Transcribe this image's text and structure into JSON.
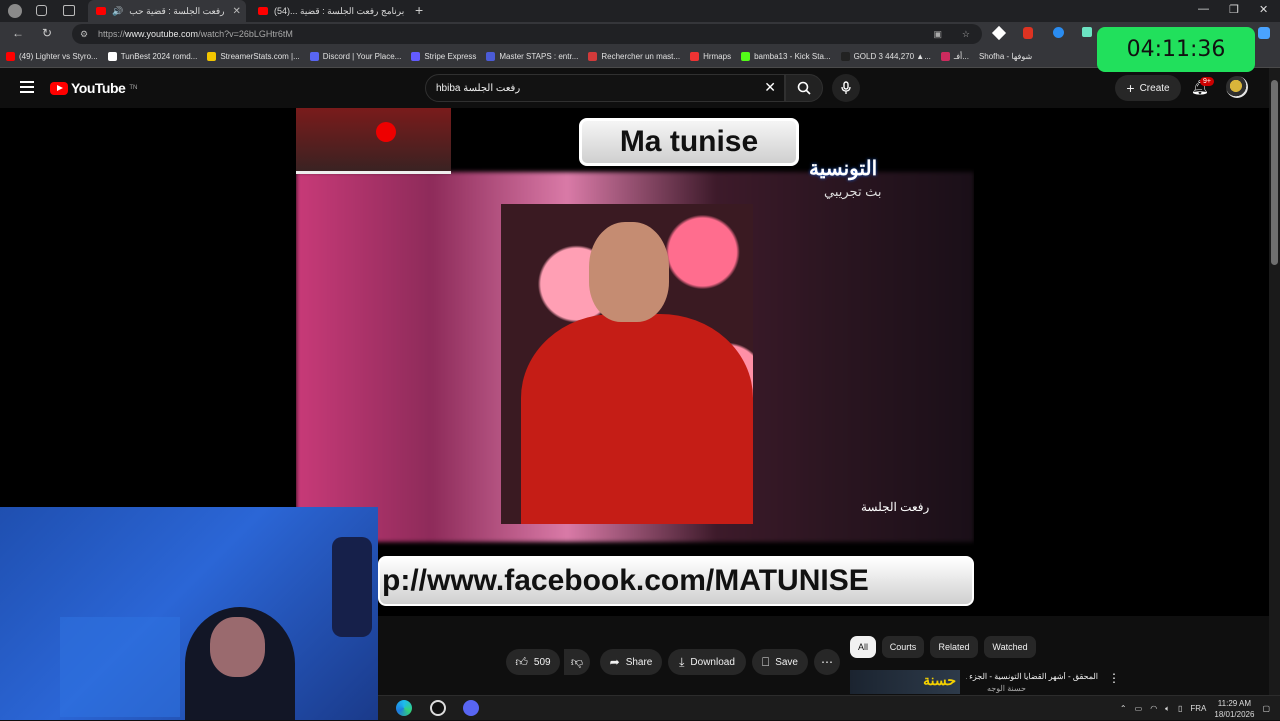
{
  "browser": {
    "tabs": [
      {
        "title": "رفعت الجلسة : قضية حب",
        "active": true
      },
      {
        "title": "برنامج رفعت الجلسة : قضية ...(54)",
        "active": false
      }
    ],
    "tab_count_label": "(54)",
    "url_prefix": "https://",
    "url_domain": "www.youtube.com",
    "url_path": "/watch?v=26bLGHtr6tM",
    "bookmarks": [
      {
        "label": "(49) Lighter vs Styro...",
        "color": "#ff0000"
      },
      {
        "label": "TunBest 2024 romd...",
        "color": "#ffffff"
      },
      {
        "label": "StreamerStats.com |...",
        "color": "#f2c500"
      },
      {
        "label": "Discord | Your Place...",
        "color": "#5865f2"
      },
      {
        "label": "Stripe Express",
        "color": "#635bff"
      },
      {
        "label": "Master STAPS : entr...",
        "color": "#4b5bd6"
      },
      {
        "label": "Rechercher un mast...",
        "color": "#d23a3a"
      },
      {
        "label": "Hrmaps",
        "color": "#e33"
      },
      {
        "label": "bamba13 - Kick Sta...",
        "color": "#53fc18"
      },
      {
        "label": "GOLD 3 444,270 ▲...",
        "color": "#222222"
      },
      {
        "label": "أفـ...",
        "color": "#cc2b5e"
      },
      {
        "label": "Shofha - شوفها",
        "color": "#888888"
      }
    ]
  },
  "overlay": {
    "timer": "04:11:36"
  },
  "youtube": {
    "logo_text": "YouTube",
    "logo_region": "TN",
    "search_value": "hbiba رفعت الجلسة",
    "create_label": "Create",
    "notif_count": "9+"
  },
  "video": {
    "top_box_text": "Ma tunise",
    "channel_arabic": "التونسية",
    "channel_sub": "بث تجريبي",
    "corner_logo": "رفعت الجلسة",
    "banner_text": "p://www.facebook.com/MATUNISE"
  },
  "actions": {
    "like_count": "509",
    "share_label": "Share",
    "download_label": "Download",
    "save_label": "Save"
  },
  "chips": [
    "All",
    "Courts",
    "Related",
    "Watched"
  ],
  "recommendation": {
    "title": "المحقق - أشهر القضايا التونسية - الجزء 1 -",
    "subtitle": "حسنة الوجه",
    "thumb_text": "حسنة"
  },
  "taskbar": {
    "lang": "FRA",
    "time": "11:29 AM",
    "date": "18/01/2026"
  },
  "colors": {
    "timer_bg": "#21e05c",
    "yt_red": "#ff0000",
    "chip_selected": "#f1f1f1"
  }
}
